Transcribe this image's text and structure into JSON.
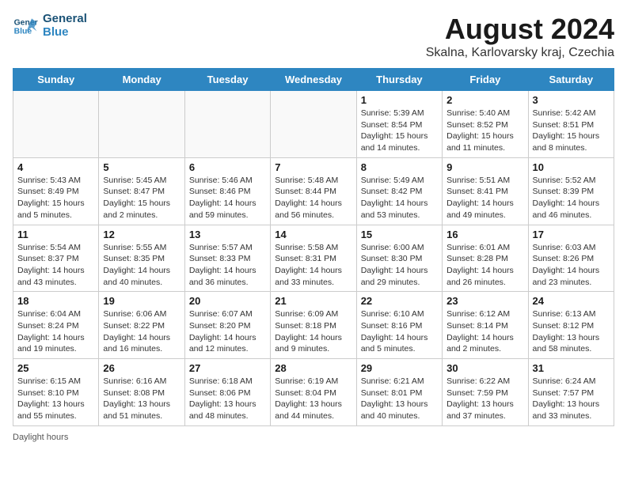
{
  "logo": {
    "line1": "General",
    "line2": "Blue"
  },
  "title": "August 2024",
  "subtitle": "Skalna, Karlovarsky kraj, Czechia",
  "days_of_week": [
    "Sunday",
    "Monday",
    "Tuesday",
    "Wednesday",
    "Thursday",
    "Friday",
    "Saturday"
  ],
  "weeks": [
    [
      {
        "day": "",
        "info": ""
      },
      {
        "day": "",
        "info": ""
      },
      {
        "day": "",
        "info": ""
      },
      {
        "day": "",
        "info": ""
      },
      {
        "day": "1",
        "info": "Sunrise: 5:39 AM\nSunset: 8:54 PM\nDaylight: 15 hours\nand 14 minutes."
      },
      {
        "day": "2",
        "info": "Sunrise: 5:40 AM\nSunset: 8:52 PM\nDaylight: 15 hours\nand 11 minutes."
      },
      {
        "day": "3",
        "info": "Sunrise: 5:42 AM\nSunset: 8:51 PM\nDaylight: 15 hours\nand 8 minutes."
      }
    ],
    [
      {
        "day": "4",
        "info": "Sunrise: 5:43 AM\nSunset: 8:49 PM\nDaylight: 15 hours\nand 5 minutes."
      },
      {
        "day": "5",
        "info": "Sunrise: 5:45 AM\nSunset: 8:47 PM\nDaylight: 15 hours\nand 2 minutes."
      },
      {
        "day": "6",
        "info": "Sunrise: 5:46 AM\nSunset: 8:46 PM\nDaylight: 14 hours\nand 59 minutes."
      },
      {
        "day": "7",
        "info": "Sunrise: 5:48 AM\nSunset: 8:44 PM\nDaylight: 14 hours\nand 56 minutes."
      },
      {
        "day": "8",
        "info": "Sunrise: 5:49 AM\nSunset: 8:42 PM\nDaylight: 14 hours\nand 53 minutes."
      },
      {
        "day": "9",
        "info": "Sunrise: 5:51 AM\nSunset: 8:41 PM\nDaylight: 14 hours\nand 49 minutes."
      },
      {
        "day": "10",
        "info": "Sunrise: 5:52 AM\nSunset: 8:39 PM\nDaylight: 14 hours\nand 46 minutes."
      }
    ],
    [
      {
        "day": "11",
        "info": "Sunrise: 5:54 AM\nSunset: 8:37 PM\nDaylight: 14 hours\nand 43 minutes."
      },
      {
        "day": "12",
        "info": "Sunrise: 5:55 AM\nSunset: 8:35 PM\nDaylight: 14 hours\nand 40 minutes."
      },
      {
        "day": "13",
        "info": "Sunrise: 5:57 AM\nSunset: 8:33 PM\nDaylight: 14 hours\nand 36 minutes."
      },
      {
        "day": "14",
        "info": "Sunrise: 5:58 AM\nSunset: 8:31 PM\nDaylight: 14 hours\nand 33 minutes."
      },
      {
        "day": "15",
        "info": "Sunrise: 6:00 AM\nSunset: 8:30 PM\nDaylight: 14 hours\nand 29 minutes."
      },
      {
        "day": "16",
        "info": "Sunrise: 6:01 AM\nSunset: 8:28 PM\nDaylight: 14 hours\nand 26 minutes."
      },
      {
        "day": "17",
        "info": "Sunrise: 6:03 AM\nSunset: 8:26 PM\nDaylight: 14 hours\nand 23 minutes."
      }
    ],
    [
      {
        "day": "18",
        "info": "Sunrise: 6:04 AM\nSunset: 8:24 PM\nDaylight: 14 hours\nand 19 minutes."
      },
      {
        "day": "19",
        "info": "Sunrise: 6:06 AM\nSunset: 8:22 PM\nDaylight: 14 hours\nand 16 minutes."
      },
      {
        "day": "20",
        "info": "Sunrise: 6:07 AM\nSunset: 8:20 PM\nDaylight: 14 hours\nand 12 minutes."
      },
      {
        "day": "21",
        "info": "Sunrise: 6:09 AM\nSunset: 8:18 PM\nDaylight: 14 hours\nand 9 minutes."
      },
      {
        "day": "22",
        "info": "Sunrise: 6:10 AM\nSunset: 8:16 PM\nDaylight: 14 hours\nand 5 minutes."
      },
      {
        "day": "23",
        "info": "Sunrise: 6:12 AM\nSunset: 8:14 PM\nDaylight: 14 hours\nand 2 minutes."
      },
      {
        "day": "24",
        "info": "Sunrise: 6:13 AM\nSunset: 8:12 PM\nDaylight: 13 hours\nand 58 minutes."
      }
    ],
    [
      {
        "day": "25",
        "info": "Sunrise: 6:15 AM\nSunset: 8:10 PM\nDaylight: 13 hours\nand 55 minutes."
      },
      {
        "day": "26",
        "info": "Sunrise: 6:16 AM\nSunset: 8:08 PM\nDaylight: 13 hours\nand 51 minutes."
      },
      {
        "day": "27",
        "info": "Sunrise: 6:18 AM\nSunset: 8:06 PM\nDaylight: 13 hours\nand 48 minutes."
      },
      {
        "day": "28",
        "info": "Sunrise: 6:19 AM\nSunset: 8:04 PM\nDaylight: 13 hours\nand 44 minutes."
      },
      {
        "day": "29",
        "info": "Sunrise: 6:21 AM\nSunset: 8:01 PM\nDaylight: 13 hours\nand 40 minutes."
      },
      {
        "day": "30",
        "info": "Sunrise: 6:22 AM\nSunset: 7:59 PM\nDaylight: 13 hours\nand 37 minutes."
      },
      {
        "day": "31",
        "info": "Sunrise: 6:24 AM\nSunset: 7:57 PM\nDaylight: 13 hours\nand 33 minutes."
      }
    ]
  ],
  "legend": "Daylight hours"
}
